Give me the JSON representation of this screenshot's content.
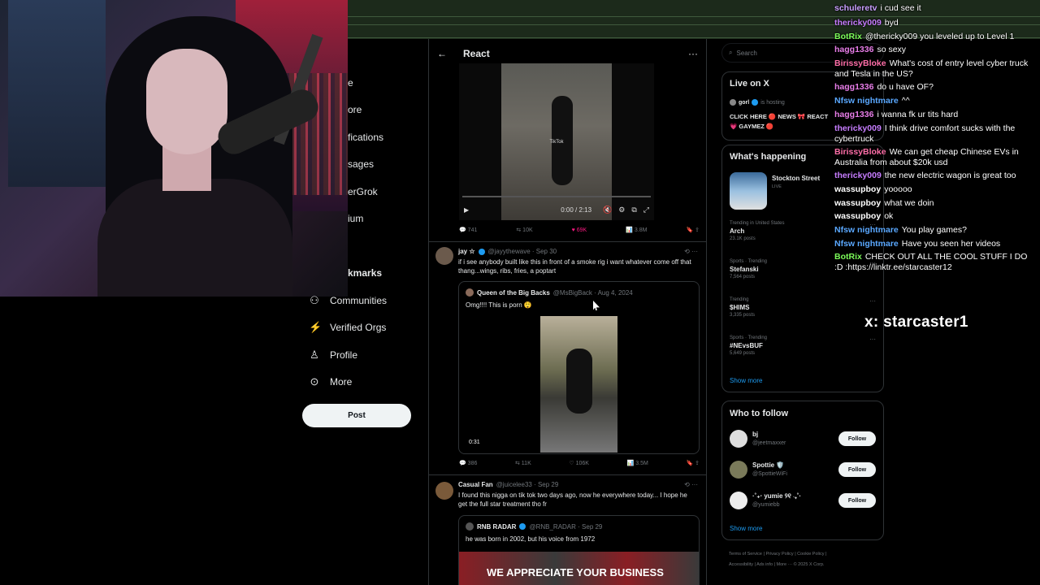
{
  "nav": {
    "partial_items": [
      "e",
      "ore",
      "fications",
      "sages",
      "erGrok",
      "ium"
    ],
    "bookmarks_partial": "kmarks",
    "items": [
      {
        "label": "Communities",
        "icon": "communities-icon"
      },
      {
        "label": "Verified Orgs",
        "icon": "lightning-icon"
      },
      {
        "label": "Profile",
        "icon": "profile-icon"
      },
      {
        "label": "More",
        "icon": "more-circle-icon"
      }
    ],
    "post_label": "Post"
  },
  "timeline": {
    "header_title": "React",
    "video1": {
      "time": "0:00 / 2:13",
      "tiktok_label": "TikTok",
      "stats": {
        "replies": "741",
        "reposts": "10K",
        "likes": "69K",
        "views": "3.8M"
      }
    },
    "tweet1": {
      "name": "jay ☆",
      "handle": "@jayythewave · Sep 30",
      "text": "if i see anybody built like this in front of a smoke rig i want whatever come off that thang...wings, ribs, fries, a poptart",
      "quote": {
        "name": "Queen of the Big Backs",
        "handle": "@MsBigBack · Aug 4, 2024",
        "text": "Omg!!!! This is porn 😲",
        "duration": "0:31"
      },
      "stats": {
        "replies": "386",
        "reposts": "11K",
        "likes": "106K",
        "views": "3.5M"
      }
    },
    "tweet2": {
      "name": "Casual Fan",
      "handle": "@juicelee33 · Sep 29",
      "text": "I found this nigga on tik tok two days ago, now he everywhere today... I hope he get the full star treatment tho fr",
      "quote": {
        "name": "RNB RADAR",
        "handle": "@RNB_RADAR · Sep 29",
        "text": "he was born in 2002, but his voice from 1972",
        "image_text": "WE APPRECIATE YOUR BUSINESS"
      }
    }
  },
  "right": {
    "search_placeholder": "Search",
    "live": {
      "title": "Live on X",
      "host": "gorl",
      "host_suffix": "is hosting",
      "text": "CLICK HERE 🔴 NEWS 🎀 REACT",
      "text2": "💗 GAYMEZ 🔴"
    },
    "happening": {
      "title": "What's happening",
      "featured": {
        "name": "Stockton Street",
        "status": "LIVE"
      },
      "trends": [
        {
          "label": "Trending in United States",
          "name": "Arch",
          "posts": "23.1K posts"
        },
        {
          "label": "Sports · Trending",
          "name": "Stefanski",
          "posts": "7,564 posts"
        },
        {
          "label": "Trending",
          "name": "$HIMS",
          "posts": "3,335 posts"
        },
        {
          "label": "Sports · Trending",
          "name": "#NEvsBUF",
          "posts": "5,649 posts"
        }
      ],
      "show_more": "Show more"
    },
    "who_to_follow": {
      "title": "Who to follow",
      "users": [
        {
          "name": "bj",
          "handle": "@jeetmaxxer"
        },
        {
          "name": "Spottie 🛡️",
          "handle": "@SpottieWiFi"
        },
        {
          "name": "·˚₊‧ yumie ୨୧ ‧₊˚·",
          "handle": "@yumiebb"
        }
      ],
      "follow_label": "Follow",
      "show_more": "Show more"
    },
    "footer": {
      "line1": "Terms of Service  |  Privacy Policy  |  Cookie Policy  |",
      "line2": "Accessibility  |  Ads info  |  More ···  © 2025 X Corp."
    }
  },
  "chat": [
    {
      "user": "schuleretv",
      "color": "#c9a0ff",
      "text": "i cud see it"
    },
    {
      "user": "thericky009",
      "color": "#c77dff",
      "text": "byd"
    },
    {
      "user": "BotRix",
      "color": "#7cfc5a",
      "text": "@thericky009 you leveled up to Level 1"
    },
    {
      "user": "hagg1336",
      "color": "#e87de8",
      "text": "so sexy"
    },
    {
      "user": "BirissyBloke",
      "color": "#ff6ea8",
      "text": "What's cost of entry level cyber truck and Tesla in the US?"
    },
    {
      "user": "hagg1336",
      "color": "#e87de8",
      "text": "do u have OF?"
    },
    {
      "user": "Nfsw nightmare",
      "color": "#5aa8ff",
      "text": "^^"
    },
    {
      "user": "hagg1336",
      "color": "#e87de8",
      "text": "i wanna fk ur tits hard"
    },
    {
      "user": "thericky009",
      "color": "#c77dff",
      "text": "I think drive comfort sucks with the cybertruck"
    },
    {
      "user": "BirissyBloke",
      "color": "#ff6ea8",
      "text": "We can get cheap Chinese EVs in Australia from about $20k usd"
    },
    {
      "user": "thericky009",
      "color": "#c77dff",
      "text": "the new electric wagon is great too"
    },
    {
      "user": "wassupboy",
      "color": "#ffffff",
      "text": "yooooo"
    },
    {
      "user": "wassupboy",
      "color": "#ffffff",
      "text": "what we doin"
    },
    {
      "user": "wassupboy",
      "color": "#ffffff",
      "text": "ok"
    },
    {
      "user": "Nfsw nightmare",
      "color": "#5aa8ff",
      "text": "You play games?"
    },
    {
      "user": "Nfsw nightmare",
      "color": "#5aa8ff",
      "text": "Have you seen her videos"
    },
    {
      "user": "BotRix",
      "color": "#7cfc5a",
      "text": "CHECK OUT ALL THE COOL STUFF I DO :D :https://linktr.ee/starcaster12"
    }
  ],
  "overlay_handle": "x: starcaster1"
}
